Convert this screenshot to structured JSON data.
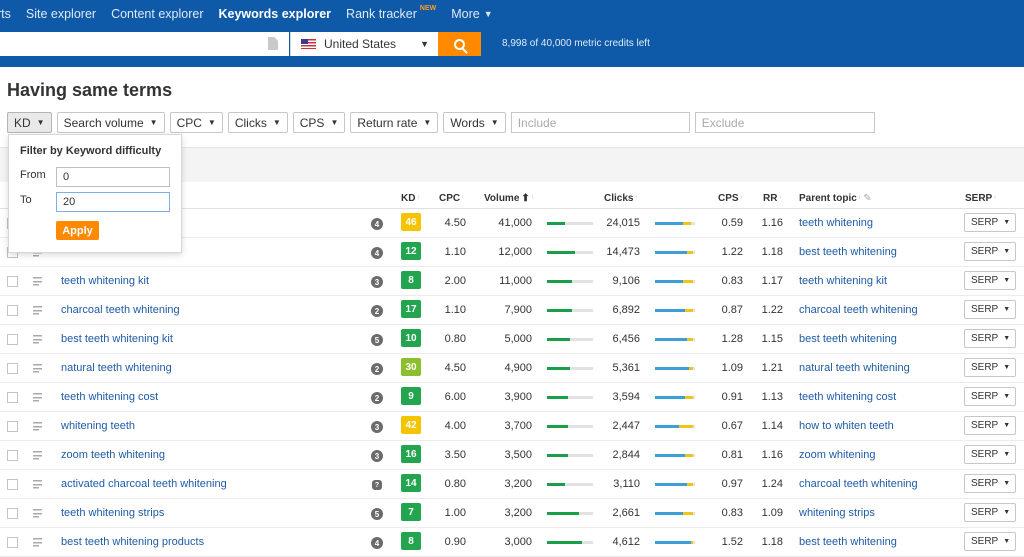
{
  "nav": {
    "items": [
      {
        "label": "rts",
        "active": false
      },
      {
        "label": "Site explorer",
        "active": false
      },
      {
        "label": "Content explorer",
        "active": false
      },
      {
        "label": "Keywords explorer",
        "active": true
      },
      {
        "label": "Rank tracker",
        "active": false,
        "badge": "NEW"
      },
      {
        "label": "More",
        "active": false
      }
    ]
  },
  "search": {
    "country": "United States",
    "credits": "8,998 of 40,000 metric credits left"
  },
  "page": {
    "title": "Having same terms"
  },
  "filters": {
    "buttons": [
      "KD",
      "Search volume",
      "CPC",
      "Clicks",
      "CPS",
      "Return rate",
      "Words"
    ],
    "include_placeholder": "Include",
    "exclude_placeholder": "Exclude"
  },
  "kd_popover": {
    "title": "Filter by Keyword difficulty",
    "from_label": "From",
    "from_value": "0",
    "to_label": "To",
    "to_value": "20",
    "apply_label": "Apply"
  },
  "table": {
    "headers": {
      "kd": "KD",
      "cpc": "CPC",
      "volume": "Volume",
      "clicks": "Clicks",
      "cps": "CPS",
      "rr": "RR",
      "parent": "Parent topic",
      "serp": "SERP"
    },
    "serp_label": "SERP",
    "colors": {
      "kd_yellow": "#f5c400",
      "kd_green": "#23a550",
      "kd_lightgreen": "#8cbf2d"
    },
    "rows": [
      {
        "keyword": "",
        "words": "4",
        "kd": "46",
        "kd_color": "#f5c400",
        "cpc": "4.50",
        "volume": "41,000",
        "vol_frac": 0.4,
        "clicks": "24,015",
        "click_a": 0.7,
        "click_b": 0.2,
        "cps": "0.59",
        "rr": "1.16",
        "parent": "teeth whitening"
      },
      {
        "keyword": "",
        "words": "4",
        "kd": "12",
        "kd_color": "#23a550",
        "cpc": "1.10",
        "volume": "12,000",
        "vol_frac": 0.6,
        "clicks": "14,473",
        "click_a": 0.8,
        "click_b": 0.15,
        "cps": "1.22",
        "rr": "1.18",
        "parent": "best teeth whitening"
      },
      {
        "keyword": "teeth whitening kit",
        "words": "3",
        "kd": "8",
        "kd_color": "#23a550",
        "cpc": "2.00",
        "volume": "11,000",
        "vol_frac": 0.55,
        "clicks": "9,106",
        "click_a": 0.7,
        "click_b": 0.25,
        "cps": "0.83",
        "rr": "1.17",
        "parent": "teeth whitening kit"
      },
      {
        "keyword": "charcoal teeth whitening",
        "words": "2",
        "kd": "17",
        "kd_color": "#23a550",
        "cpc": "1.10",
        "volume": "7,900",
        "vol_frac": 0.55,
        "clicks": "6,892",
        "click_a": 0.75,
        "click_b": 0.2,
        "cps": "0.87",
        "rr": "1.22",
        "parent": "charcoal teeth whitening"
      },
      {
        "keyword": "best teeth whitening kit",
        "words": "5",
        "kd": "10",
        "kd_color": "#23a550",
        "cpc": "0.80",
        "volume": "5,000",
        "vol_frac": 0.5,
        "clicks": "6,456",
        "click_a": 0.8,
        "click_b": 0.15,
        "cps": "1.28",
        "rr": "1.15",
        "parent": "best teeth whitening"
      },
      {
        "keyword": "natural teeth whitening",
        "words": "2",
        "kd": "30",
        "kd_color": "#8cbf2d",
        "cpc": "4.50",
        "volume": "4,900",
        "vol_frac": 0.5,
        "clicks": "5,361",
        "click_a": 0.85,
        "click_b": 0.1,
        "cps": "1.09",
        "rr": "1.21",
        "parent": "natural teeth whitening"
      },
      {
        "keyword": "teeth whitening cost",
        "words": "2",
        "kd": "9",
        "kd_color": "#23a550",
        "cpc": "6.00",
        "volume": "3,900",
        "vol_frac": 0.45,
        "clicks": "3,594",
        "click_a": 0.75,
        "click_b": 0.2,
        "cps": "0.91",
        "rr": "1.13",
        "parent": "teeth whitening cost"
      },
      {
        "keyword": "whitening teeth",
        "words": "3",
        "kd": "42",
        "kd_color": "#f5c400",
        "cpc": "4.00",
        "volume": "3,700",
        "vol_frac": 0.45,
        "clicks": "2,447",
        "click_a": 0.6,
        "click_b": 0.35,
        "cps": "0.67",
        "rr": "1.14",
        "parent": "how to whiten teeth"
      },
      {
        "keyword": "zoom teeth whitening",
        "words": "3",
        "kd": "16",
        "kd_color": "#23a550",
        "cpc": "3.50",
        "volume": "3,500",
        "vol_frac": 0.45,
        "clicks": "2,844",
        "click_a": 0.75,
        "click_b": 0.2,
        "cps": "0.81",
        "rr": "1.16",
        "parent": "zoom whitening"
      },
      {
        "keyword": "activated charcoal teeth whitening",
        "words": "",
        "kd": "14",
        "kd_color": "#23a550",
        "cpc": "0.80",
        "volume": "3,200",
        "vol_frac": 0.4,
        "clicks": "3,110",
        "click_a": 0.8,
        "click_b": 0.15,
        "cps": "0.97",
        "rr": "1.24",
        "parent": "charcoal teeth whitening"
      },
      {
        "keyword": "teeth whitening strips",
        "words": "5",
        "kd": "7",
        "kd_color": "#23a550",
        "cpc": "1.00",
        "volume": "3,200",
        "vol_frac": 0.7,
        "clicks": "2,661",
        "click_a": 0.7,
        "click_b": 0.25,
        "cps": "0.83",
        "rr": "1.09",
        "parent": "whitening strips"
      },
      {
        "keyword": "best teeth whitening products",
        "words": "4",
        "kd": "8",
        "kd_color": "#23a550",
        "cpc": "0.90",
        "volume": "3,000",
        "vol_frac": 0.75,
        "clicks": "4,612",
        "click_a": 0.9,
        "click_b": 0.05,
        "cps": "1.52",
        "rr": "1.18",
        "parent": "best teeth whitening"
      }
    ]
  }
}
